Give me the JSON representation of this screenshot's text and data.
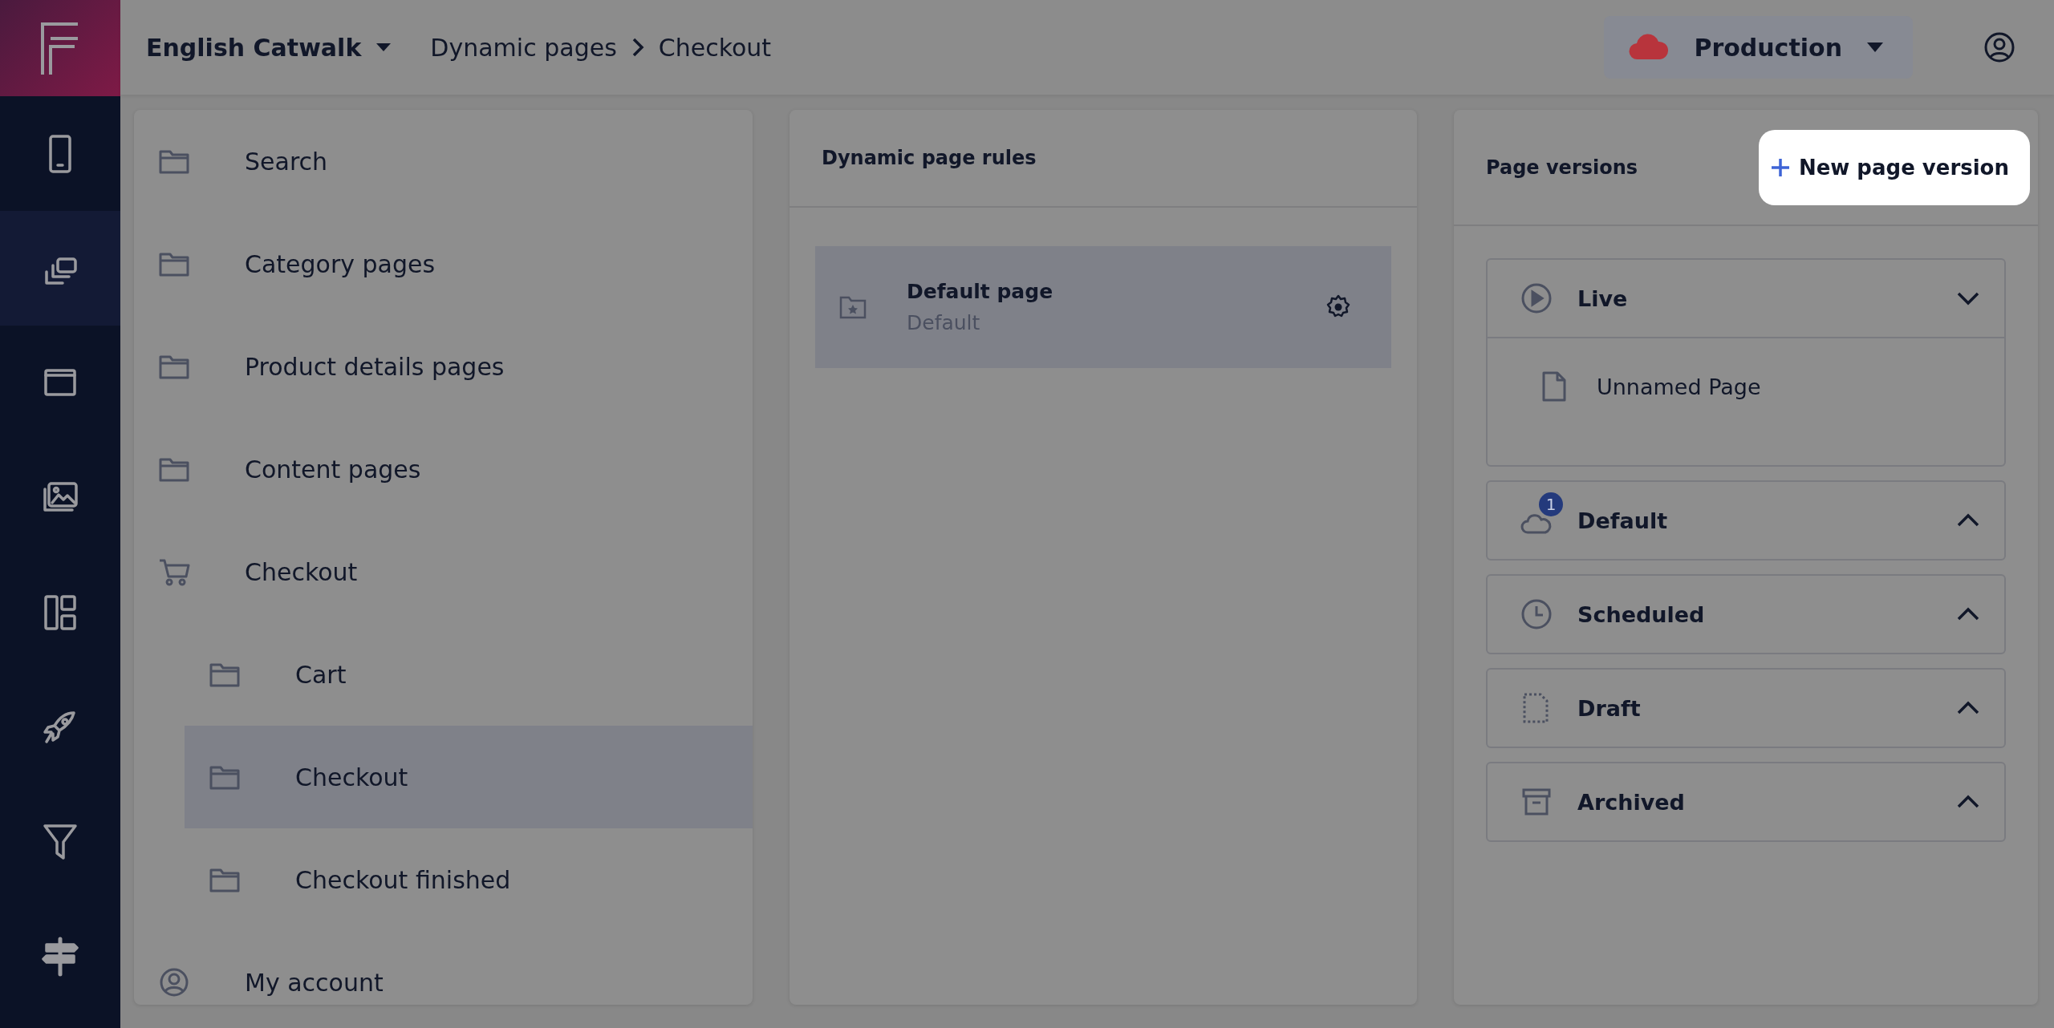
{
  "header": {
    "site": "English Catwalk",
    "breadcrumb": [
      "Dynamic pages",
      "Checkout"
    ],
    "environment": "Production"
  },
  "sidebar": {
    "items": [
      {
        "selected": false
      },
      {
        "selected": true
      },
      {
        "selected": false
      },
      {
        "selected": false
      },
      {
        "selected": false
      },
      {
        "selected": false
      },
      {
        "selected": false
      },
      {
        "selected": false
      }
    ]
  },
  "tree": [
    {
      "label": "Search",
      "kind": "folder",
      "selected": false
    },
    {
      "label": "Category pages",
      "kind": "folder",
      "selected": false
    },
    {
      "label": "Product details pages",
      "kind": "folder",
      "selected": false
    },
    {
      "label": "Content pages",
      "kind": "folder",
      "selected": false
    },
    {
      "label": "Checkout",
      "kind": "cart",
      "selected": false,
      "children": [
        {
          "label": "Cart",
          "kind": "folder",
          "selected": false
        },
        {
          "label": "Checkout",
          "kind": "folder",
          "selected": true
        },
        {
          "label": "Checkout finished",
          "kind": "folder",
          "selected": false
        }
      ]
    },
    {
      "label": "My account",
      "kind": "user",
      "selected": false
    }
  ],
  "rules": {
    "title": "Dynamic page rules",
    "items": [
      {
        "name": "Default page",
        "subtitle": "Default",
        "selected": true
      }
    ]
  },
  "versions": {
    "title": "Page versions",
    "new_button": "New page version",
    "sections": [
      {
        "label": "Live",
        "kind": "live",
        "expanded": true,
        "pages": [
          "Unnamed Page"
        ]
      },
      {
        "label": "Default",
        "kind": "default",
        "expanded": false,
        "badge": "1"
      },
      {
        "label": "Scheduled",
        "kind": "scheduled",
        "expanded": false
      },
      {
        "label": "Draft",
        "kind": "draft",
        "expanded": false
      },
      {
        "label": "Archived",
        "kind": "archived",
        "expanded": false
      }
    ]
  }
}
